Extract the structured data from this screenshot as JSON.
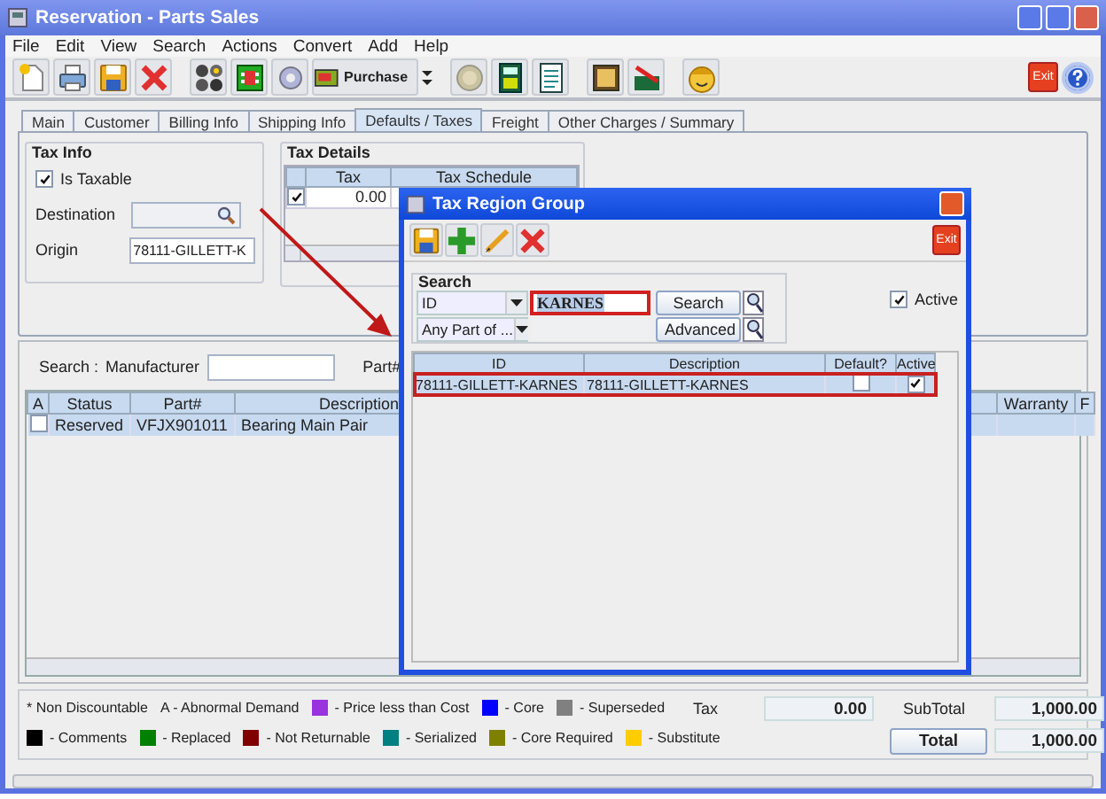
{
  "window": {
    "title": "Reservation - Parts Sales"
  },
  "menu": [
    "File",
    "Edit",
    "View",
    "Search",
    "Actions",
    "Convert",
    "Add",
    "Help"
  ],
  "toolbar": {
    "purchase_label": "Purchase",
    "exit_label": "Exit"
  },
  "tabs": [
    {
      "label": "Main",
      "selected": false
    },
    {
      "label": "Customer",
      "selected": false
    },
    {
      "label": "Billing Info",
      "selected": false
    },
    {
      "label": "Shipping Info",
      "selected": false
    },
    {
      "label": "Defaults / Taxes",
      "selected": true
    },
    {
      "label": "Freight",
      "selected": false
    },
    {
      "label": "Other Charges / Summary",
      "selected": false
    }
  ],
  "tax_info": {
    "title": "Tax Info",
    "is_taxable": {
      "label": "Is Taxable",
      "checked": true
    },
    "destination": {
      "label": "Destination"
    },
    "origin": {
      "label": "Origin",
      "value": "78111-GILLETT-K"
    }
  },
  "tax_details": {
    "title": "Tax Details",
    "columns": [
      "Tax",
      "Tax Schedule"
    ],
    "rows": [
      {
        "checked": true,
        "tax": "0.00"
      }
    ]
  },
  "parts_search": {
    "label": "Search :",
    "fields": [
      {
        "label": "Manufacturer"
      },
      {
        "label": "Part#"
      }
    ]
  },
  "parts_table": {
    "columns": [
      "A",
      "Status",
      "Part#",
      "Description",
      "Warranty",
      "F"
    ],
    "rows": [
      {
        "checked": false,
        "status": "Reserved",
        "part": "VFJX901011",
        "description": "Bearing Main Pair"
      }
    ]
  },
  "legend": {
    "lines": [
      {
        "items": [
          {
            "kind": "text",
            "label": "* Non Discountable"
          },
          {
            "kind": "text",
            "label": "A - Abnormal Demand"
          },
          {
            "kind": "swatch",
            "color": "#9933dd",
            "label": "- Price less than Cost"
          },
          {
            "kind": "swatch",
            "color": "#0000ff",
            "label": "- Core"
          },
          {
            "kind": "swatch",
            "color": "#808080",
            "label": "- Superseded"
          }
        ]
      },
      {
        "items": [
          {
            "kind": "swatch",
            "color": "#000000",
            "label": "- Comments"
          },
          {
            "kind": "swatch",
            "color": "#008000",
            "label": "- Replaced"
          },
          {
            "kind": "swatch",
            "color": "#800000",
            "label": "- Not Returnable"
          },
          {
            "kind": "swatch",
            "color": "#008080",
            "label": "- Serialized"
          },
          {
            "kind": "swatch",
            "color": "#808000",
            "label": "- Core Required"
          },
          {
            "kind": "swatch",
            "color": "#ffcc00",
            "label": "- Substitute"
          }
        ]
      }
    ]
  },
  "totals": {
    "tax_label": "Tax",
    "tax": "0.00",
    "subtotal_label": "SubTotal",
    "subtotal": "1,000.00",
    "total_button": "Total",
    "total": "1,000.00"
  },
  "dialog": {
    "title": "Tax Region Group",
    "exit_label": "Exit",
    "search": {
      "title": "Search",
      "field_select": "ID",
      "match_select": "Any Part of ...",
      "query": "KARNES",
      "buttons": [
        "Search",
        "Advanced"
      ]
    },
    "active": {
      "label": "Active",
      "checked": true
    },
    "columns": [
      "ID",
      "Description",
      "Default?",
      "Active"
    ],
    "rows": [
      {
        "id": "78111-GILLETT-KARNES",
        "description": "78111-GILLETT-KARNES",
        "default": false,
        "active": true,
        "selected": true
      }
    ]
  }
}
